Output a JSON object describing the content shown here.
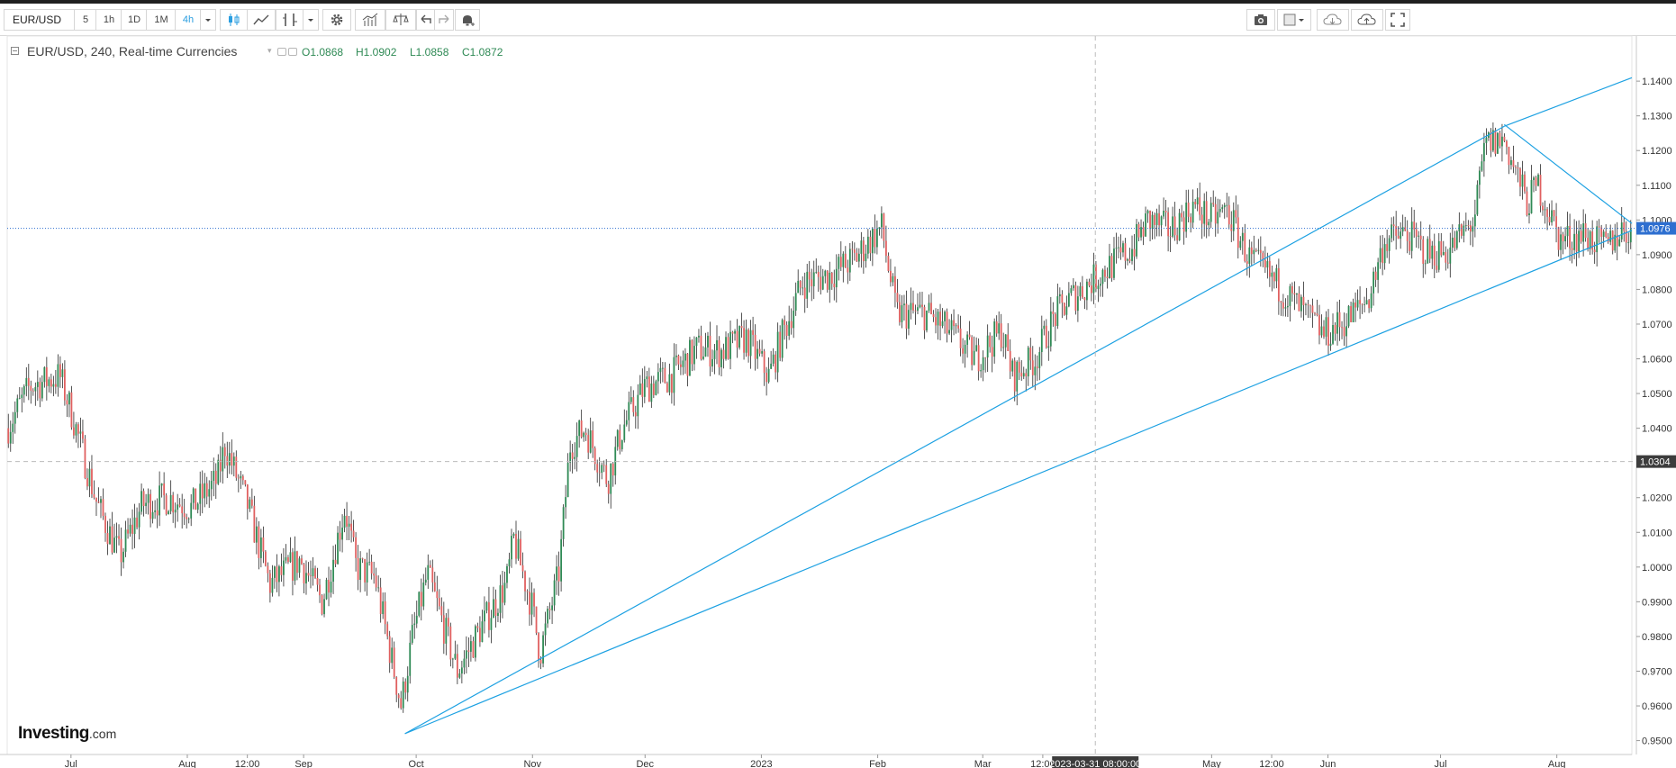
{
  "toolbar": {
    "symbol": "EUR/USD",
    "intervals": [
      "5",
      "1h",
      "1D",
      "1M",
      "4h"
    ],
    "active_interval": "4h",
    "icons": {
      "interval_menu": "chevron-down-icon",
      "candles": "candlestick-icon",
      "line": "line-chart-icon",
      "draw": "drawing-tools-icon",
      "draw_menu": "chevron-down-icon",
      "settings": "gear-icon",
      "indicators": "indicators-icon",
      "compare": "scale-compare-icon",
      "undo": "undo-icon",
      "redo": "redo-icon",
      "alert": "bell-plus-icon",
      "snapshot": "camera-icon",
      "layout": "layout-square-icon",
      "layout_menu": "chevron-down-icon",
      "load": "cloud-download-icon",
      "save": "cloud-upload-icon",
      "fullscreen": "fullscreen-icon"
    }
  },
  "legend": {
    "title": "EUR/USD, 240, Real-time Currencies",
    "open": "O1.0868",
    "high": "H1.0902",
    "low": "L1.0858",
    "close": "C1.0872"
  },
  "logo": {
    "brand": "Investing",
    "suffix": ".com"
  },
  "colors": {
    "up": "#2f8a55",
    "down": "#e06060",
    "wick": "#2a2a2a",
    "trendline": "#1da1e2",
    "last_price_label": "#2e6fd0",
    "crosshair_label": "#3c3c3c",
    "grid_dash": "#bcbcbc"
  },
  "chart_data": {
    "type": "candlestick",
    "symbol": "EUR/USD",
    "interval": "240",
    "y_axis": {
      "ticks": [
        "1.1400",
        "1.1300",
        "1.1200",
        "1.1100",
        "1.1000",
        "1.0900",
        "1.0800",
        "1.0700",
        "1.0600",
        "1.0500",
        "1.0400",
        "1.0300",
        "1.0200",
        "1.0100",
        "1.0000",
        "0.9900",
        "0.9800",
        "0.9700",
        "0.9600",
        "0.9500"
      ],
      "range": [
        0.946,
        1.153
      ]
    },
    "x_axis": {
      "range": [
        "2022-06-14",
        "2023-08-21"
      ],
      "ticks": [
        {
          "label": "Jul",
          "date": "2022-07-01"
        },
        {
          "label": "Aug",
          "date": "2022-08-01"
        },
        {
          "label": "12:00",
          "date": "2022-08-17"
        },
        {
          "label": "Sep",
          "date": "2022-09-01"
        },
        {
          "label": "Oct",
          "date": "2022-10-01"
        },
        {
          "label": "Nov",
          "date": "2022-11-01"
        },
        {
          "label": "Dec",
          "date": "2022-12-01"
        },
        {
          "label": "2023",
          "date": "2023-01-01"
        },
        {
          "label": "Feb",
          "date": "2023-02-01"
        },
        {
          "label": "Mar",
          "date": "2023-03-01"
        },
        {
          "label": "12:00",
          "date": "2023-03-17"
        },
        {
          "label": "May",
          "date": "2023-05-01"
        },
        {
          "label": "12:00",
          "date": "2023-05-17"
        },
        {
          "label": "Jun",
          "date": "2023-06-01"
        },
        {
          "label": "Jul",
          "date": "2023-07-01"
        },
        {
          "label": "Aug",
          "date": "2023-08-01"
        }
      ]
    },
    "close_path": [
      [
        "2022-06-14",
        1.04
      ],
      [
        "2022-06-20",
        1.052
      ],
      [
        "2022-06-28",
        1.055
      ],
      [
        "2022-07-01",
        1.045
      ],
      [
        "2022-07-08",
        1.018
      ],
      [
        "2022-07-14",
        1.003
      ],
      [
        "2022-07-20",
        1.018
      ],
      [
        "2022-07-27",
        1.02
      ],
      [
        "2022-08-02",
        1.017
      ],
      [
        "2022-08-09",
        1.025
      ],
      [
        "2022-08-11",
        1.035
      ],
      [
        "2022-08-17",
        1.018
      ],
      [
        "2022-08-23",
        0.995
      ],
      [
        "2022-08-31",
        1.002
      ],
      [
        "2022-09-06",
        0.99
      ],
      [
        "2022-09-12",
        1.017
      ],
      [
        "2022-09-15",
        1.0
      ],
      [
        "2022-09-20",
        0.997
      ],
      [
        "2022-09-27",
        0.96
      ],
      [
        "2022-09-30",
        0.98
      ],
      [
        "2022-10-04",
        0.998
      ],
      [
        "2022-10-12",
        0.97
      ],
      [
        "2022-10-18",
        0.982
      ],
      [
        "2022-10-25",
        0.995
      ],
      [
        "2022-10-27",
        1.008
      ],
      [
        "2022-11-01",
        0.988
      ],
      [
        "2022-11-03",
        0.975
      ],
      [
        "2022-11-08",
        0.998
      ],
      [
        "2022-11-11",
        1.035
      ],
      [
        "2022-11-15",
        1.04
      ],
      [
        "2022-11-21",
        1.025
      ],
      [
        "2022-11-25",
        1.04
      ],
      [
        "2022-12-01",
        1.052
      ],
      [
        "2022-12-08",
        1.055
      ],
      [
        "2022-12-15",
        1.063
      ],
      [
        "2022-12-21",
        1.062
      ],
      [
        "2022-12-28",
        1.066
      ],
      [
        "2023-01-03",
        1.055
      ],
      [
        "2023-01-06",
        1.065
      ],
      [
        "2023-01-12",
        1.082
      ],
      [
        "2023-01-19",
        1.084
      ],
      [
        "2023-01-26",
        1.089
      ],
      [
        "2023-02-02",
        1.098
      ],
      [
        "2023-02-06",
        1.073
      ],
      [
        "2023-02-14",
        1.073
      ],
      [
        "2023-02-20",
        1.068
      ],
      [
        "2023-02-27",
        1.06
      ],
      [
        "2023-03-06",
        1.068
      ],
      [
        "2023-03-09",
        1.055
      ],
      [
        "2023-03-15",
        1.06
      ],
      [
        "2023-03-20",
        1.072
      ],
      [
        "2023-03-24",
        1.077
      ],
      [
        "2023-04-03",
        1.086
      ],
      [
        "2023-04-10",
        1.092
      ],
      [
        "2023-04-14",
        1.1
      ],
      [
        "2023-04-20",
        1.097
      ],
      [
        "2023-04-26",
        1.104
      ],
      [
        "2023-05-01",
        1.1
      ],
      [
        "2023-05-05",
        1.103
      ],
      [
        "2023-05-11",
        1.089
      ],
      [
        "2023-05-17",
        1.083
      ],
      [
        "2023-05-24",
        1.075
      ],
      [
        "2023-05-31",
        1.067
      ],
      [
        "2023-06-06",
        1.071
      ],
      [
        "2023-06-12",
        1.078
      ],
      [
        "2023-06-16",
        1.094
      ],
      [
        "2023-06-22",
        1.096
      ],
      [
        "2023-06-28",
        1.09
      ],
      [
        "2023-07-03",
        1.091
      ],
      [
        "2023-07-10",
        1.1
      ],
      [
        "2023-07-13",
        1.122
      ],
      [
        "2023-07-18",
        1.123
      ],
      [
        "2023-07-24",
        1.105
      ],
      [
        "2023-07-27",
        1.11
      ],
      [
        "2023-08-02",
        1.094
      ],
      [
        "2023-08-08",
        1.096
      ],
      [
        "2023-08-14",
        1.092
      ],
      [
        "2023-08-18",
        1.097
      ]
    ],
    "trendlines": [
      {
        "name": "steep-support",
        "from": [
          "2022-09-28",
          0.952
        ],
        "to": [
          "2023-07-18",
          1.127
        ]
      },
      {
        "name": "upper-channel",
        "from": [
          "2023-07-18",
          1.127
        ],
        "to": [
          "2023-08-21",
          1.141
        ]
      },
      {
        "name": "lower-support",
        "from": [
          "2022-09-28",
          0.952
        ],
        "to": [
          "2023-08-21",
          1.097
        ]
      },
      {
        "name": "resistance",
        "from": [
          "2023-07-18",
          1.1275
        ],
        "to": [
          "2023-08-21",
          1.099
        ]
      }
    ],
    "last_price": 1.0976,
    "last_price_label": "1.0976",
    "crosshair": {
      "price": 1.0304,
      "price_label": "1.0304",
      "date": "2023-03-31",
      "date_label": "2023-03-31 08:00:00"
    }
  }
}
